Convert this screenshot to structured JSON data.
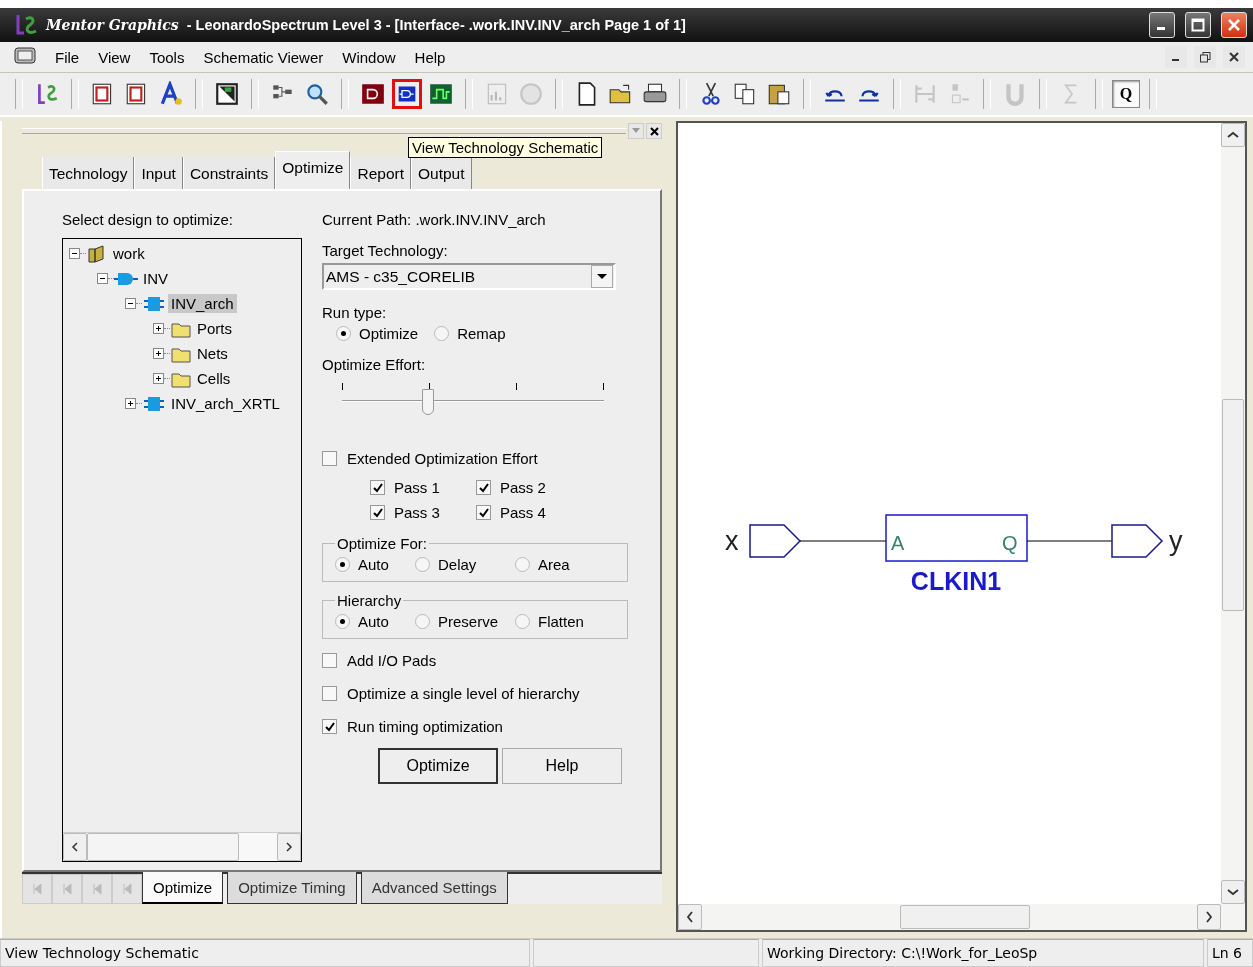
{
  "window": {
    "brand": "Mentor Graphics",
    "title": "- LeonardoSpectrum Level 3 - [Interface- .work.INV.INV_arch Page 1 of 1]"
  },
  "menu": [
    "File",
    "View",
    "Tools",
    "Schematic Viewer",
    "Window",
    "Help"
  ],
  "toolbar": [
    [
      {
        "kind": "logo",
        "disabled": false,
        "highlighted": false
      }
    ],
    [
      {
        "kind": "ge",
        "disabled": false,
        "highlighted": false
      },
      {
        "kind": "ae",
        "disabled": false,
        "highlighted": false
      },
      {
        "kind": "a",
        "disabled": false,
        "highlighted": false
      }
    ],
    [
      {
        "kind": "ns",
        "disabled": false,
        "highlighted": false
      }
    ],
    [
      {
        "kind": "hier",
        "disabled": false,
        "highlighted": false
      },
      {
        "kind": "zoom",
        "disabled": false,
        "highlighted": false
      }
    ],
    [
      {
        "kind": "rtl",
        "disabled": false,
        "highlighted": false
      },
      {
        "kind": "tech",
        "disabled": false,
        "highlighted": true
      },
      {
        "kind": "wave",
        "disabled": false,
        "highlighted": false
      }
    ],
    [
      {
        "kind": "report",
        "disabled": true,
        "highlighted": false
      },
      {
        "kind": "stop",
        "disabled": true,
        "highlighted": false
      }
    ],
    [
      {
        "kind": "new",
        "disabled": false,
        "highlighted": false
      },
      {
        "kind": "open",
        "disabled": false,
        "highlighted": false
      },
      {
        "kind": "print",
        "disabled": false,
        "highlighted": false
      }
    ],
    [
      {
        "kind": "cut",
        "disabled": false,
        "highlighted": false
      },
      {
        "kind": "copy",
        "disabled": false,
        "highlighted": false
      },
      {
        "kind": "paste",
        "disabled": false,
        "highlighted": false
      }
    ],
    [
      {
        "kind": "undo",
        "disabled": false,
        "highlighted": false
      },
      {
        "kind": "redo",
        "disabled": false,
        "highlighted": false
      }
    ],
    [
      {
        "kind": "pin",
        "disabled": true,
        "highlighted": false
      },
      {
        "kind": "unit",
        "disabled": true,
        "highlighted": false
      }
    ],
    [
      {
        "kind": "u",
        "disabled": true,
        "highlighted": false
      }
    ],
    [
      {
        "kind": "sum",
        "disabled": true,
        "highlighted": false
      }
    ]
  ],
  "q_button": {
    "label": "Q",
    "pressed": true
  },
  "tooltip": "View Technology Schematic",
  "tabs": [
    {
      "label": "Technology",
      "selected": false
    },
    {
      "label": "Input",
      "selected": false
    },
    {
      "label": "Constraints",
      "selected": false
    },
    {
      "label": "Optimize",
      "selected": true
    },
    {
      "label": "Report",
      "selected": false
    },
    {
      "label": "Output",
      "selected": false
    }
  ],
  "tree_label": "Select design to optimize:",
  "tree": [
    {
      "label": "work",
      "kind": "library",
      "expanded": true,
      "selected": false,
      "children": [
        {
          "label": "INV",
          "kind": "entity",
          "expanded": true,
          "selected": false,
          "children": [
            {
              "label": "INV_arch",
              "kind": "arch",
              "expanded": true,
              "selected": true,
              "children": [
                {
                  "label": "Ports",
                  "kind": "folder",
                  "expanded": false,
                  "selected": false
                },
                {
                  "label": "Nets",
                  "kind": "folder",
                  "expanded": false,
                  "selected": false
                },
                {
                  "label": "Cells",
                  "kind": "folder",
                  "expanded": false,
                  "selected": false
                }
              ]
            },
            {
              "label": "INV_arch_XRTL",
              "kind": "arch",
              "expanded": false,
              "selected": false
            }
          ]
        }
      ]
    }
  ],
  "current_path": "Current Path: .work.INV.INV_arch",
  "target_technology": {
    "label": "Target Technology:",
    "value": "AMS - c35_CORELIB"
  },
  "run_type": {
    "label": "Run type:",
    "options": [
      {
        "label": "Optimize",
        "selected": true
      },
      {
        "label": "Remap",
        "selected": false
      }
    ]
  },
  "effort": {
    "label": "Optimize Effort:",
    "level": 0.33
  },
  "extended": {
    "label": "Extended Optimization Effort",
    "checked": false
  },
  "passes": [
    {
      "label": "Pass 1",
      "checked": true
    },
    {
      "label": "Pass 2",
      "checked": true
    },
    {
      "label": "Pass 3",
      "checked": true
    },
    {
      "label": "Pass 4",
      "checked": true
    }
  ],
  "optimize_for": {
    "label": "Optimize For:",
    "options": [
      {
        "label": "Auto",
        "selected": true
      },
      {
        "label": "Delay",
        "selected": false
      },
      {
        "label": "Area",
        "selected": false
      }
    ]
  },
  "hierarchy": {
    "label": "Hierarchy",
    "options": [
      {
        "label": "Auto",
        "selected": true
      },
      {
        "label": "Preserve",
        "selected": false
      },
      {
        "label": "Flatten",
        "selected": false
      }
    ]
  },
  "options": [
    {
      "label": "Add I/O Pads",
      "checked": false
    },
    {
      "label": "Optimize a single level of hierarchy",
      "checked": false
    },
    {
      "label": "Run timing optimization",
      "checked": true
    }
  ],
  "buttons": [
    {
      "label": "Optimize",
      "default": true
    },
    {
      "label": "Help",
      "default": false
    }
  ],
  "bottom_tabs": [
    {
      "label": "Optimize",
      "selected": true
    },
    {
      "label": "Optimize Timing",
      "selected": false
    },
    {
      "label": "Advanced Settings",
      "selected": false
    }
  ],
  "schematic": {
    "input_port": "x",
    "output_port": "y",
    "cell": {
      "name": "CLKIN1",
      "input_pin": "A",
      "output_pin": "Q"
    }
  },
  "status_bar": {
    "message": "View Technology Schematic",
    "directory": "Working Directory: C:\\!Work_for_LeoSp",
    "line": "Ln 6"
  }
}
